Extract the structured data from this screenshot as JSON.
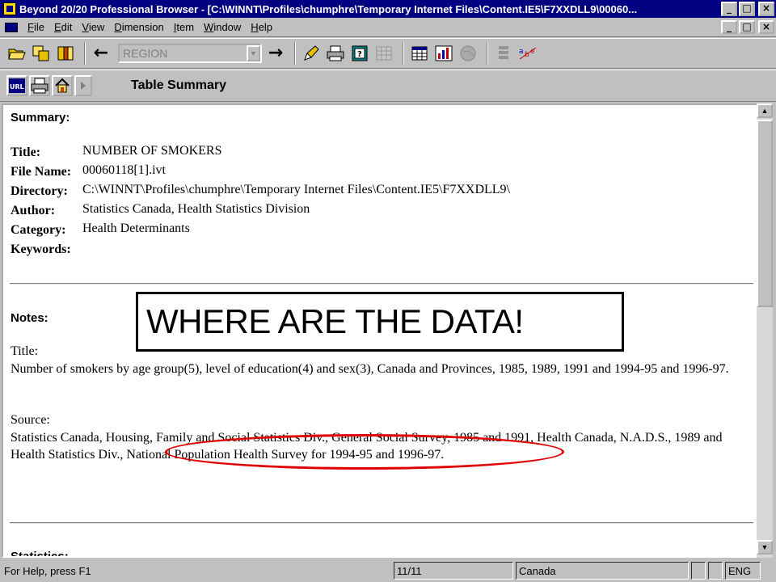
{
  "window": {
    "title": "Beyond 20/20 Professional Browser - [C:\\WINNT\\Profiles\\chumphre\\Temporary Internet Files\\Content.IE5\\F7XXDLL9\\00060...",
    "buttons": {
      "minimize": "_",
      "maximize": "□",
      "close": "×"
    }
  },
  "menu": {
    "items": [
      {
        "u": "F",
        "rest": "ile"
      },
      {
        "u": "E",
        "rest": "dit"
      },
      {
        "u": "V",
        "rest": "iew"
      },
      {
        "u": "D",
        "rest": "imension"
      },
      {
        "u": "I",
        "rest": "tem"
      },
      {
        "u": "W",
        "rest": "indow"
      },
      {
        "u": "H",
        "rest": "elp"
      }
    ]
  },
  "toolbar": {
    "dimension_select": "REGION",
    "back_arrow": "←",
    "forward_arrow": "→",
    "combo_arrow": "▼"
  },
  "nav": {
    "page_title": "Table Summary",
    "url_label": "URL"
  },
  "summary": {
    "heading": "Summary:",
    "fields": {
      "title_label": "Title:",
      "title_value": "NUMBER OF SMOKERS",
      "filename_label": "File Name:",
      "filename_value": "00060118[1].ivt",
      "directory_label": "Directory:",
      "directory_value": "C:\\WINNT\\Profiles\\chumphre\\Temporary Internet Files\\Content.IE5\\F7XXDLL9\\",
      "author_label": "Author:",
      "author_value": "Statistics Canada, Health Statistics Division",
      "category_label": "Category:",
      "category_value": "Health Determinants",
      "keywords_label": "Keywords:",
      "keywords_value": ""
    }
  },
  "notes": {
    "heading": "Notes:",
    "title_label": "Title:",
    "title_text": "Number of smokers by age group(5), level of education(4) and sex(3), Canada and Provinces, 1985, 1989, 1991 and 1994-95 and 1996-97.",
    "source_label": "Source:",
    "source_text": "Statistics Canada, Housing, Family and Social Statistics Div., General Social Survey, 1985 and 1991, Health Canada, N.A.D.S., 1989 and Health Statistics Div., National Population Health Survey for 1994-95 and 1996-97."
  },
  "statistics_heading": "Statistics:",
  "annotation": {
    "callout": "WHERE ARE THE DATA!"
  },
  "scrollbar": {
    "up": "▲",
    "down": "▼"
  },
  "status": {
    "help": "For Help, press F1",
    "page": "11/11",
    "region": "Canada",
    "language": "ENG"
  }
}
